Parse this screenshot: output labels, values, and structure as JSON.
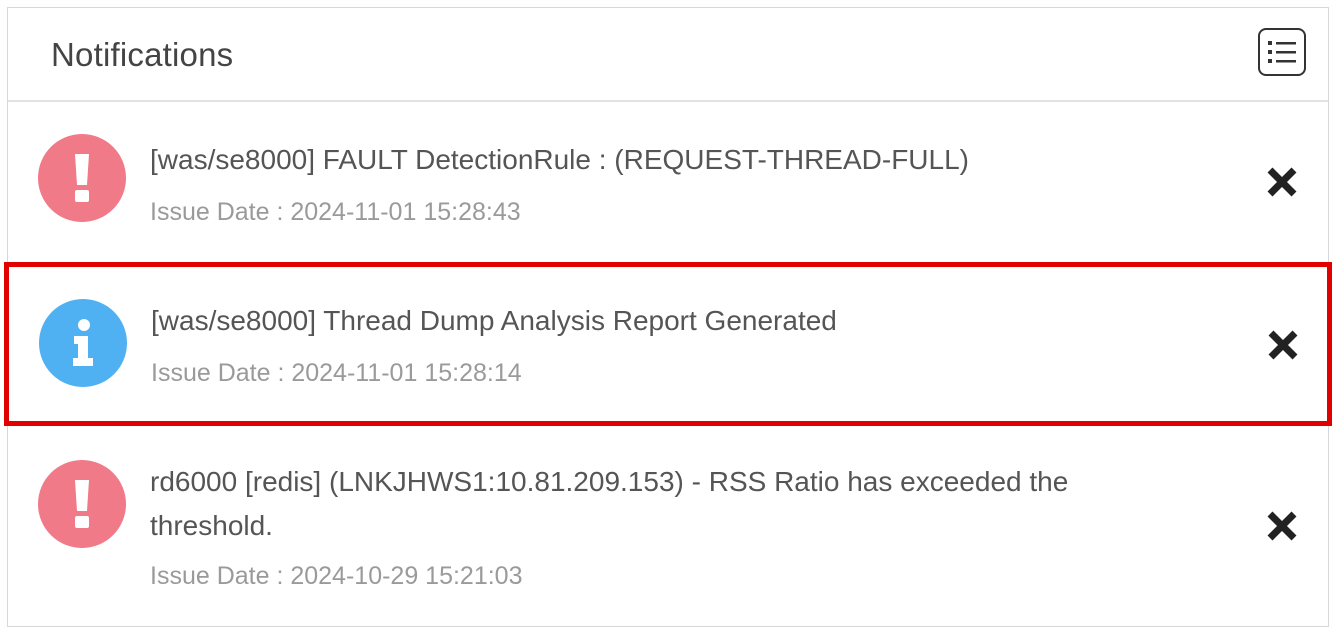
{
  "header": {
    "title": "Notifications"
  },
  "notifications": [
    {
      "type": "error",
      "icon": "exclamation-icon",
      "title": "[was/se8000] FAULT DetectionRule : (REQUEST-THREAD-FULL)",
      "date": "Issue Date : 2024-11-01 15:28:43",
      "highlighted": false
    },
    {
      "type": "info",
      "icon": "info-icon",
      "title": "[was/se8000] Thread Dump Analysis Report Generated",
      "date": "Issue Date : 2024-11-01 15:28:14",
      "highlighted": true
    },
    {
      "type": "error",
      "icon": "exclamation-icon",
      "title_line1": "rd6000 [redis] (LNKJHWS1:10.81.209.153) - RSS Ratio has exceeded the",
      "title_line2": "threshold.",
      "date": "Issue Date : 2024-10-29 15:21:03",
      "highlighted": false
    }
  ],
  "colors": {
    "error": "#f07a88",
    "info": "#4fb0f2",
    "highlight": "#e00000"
  }
}
